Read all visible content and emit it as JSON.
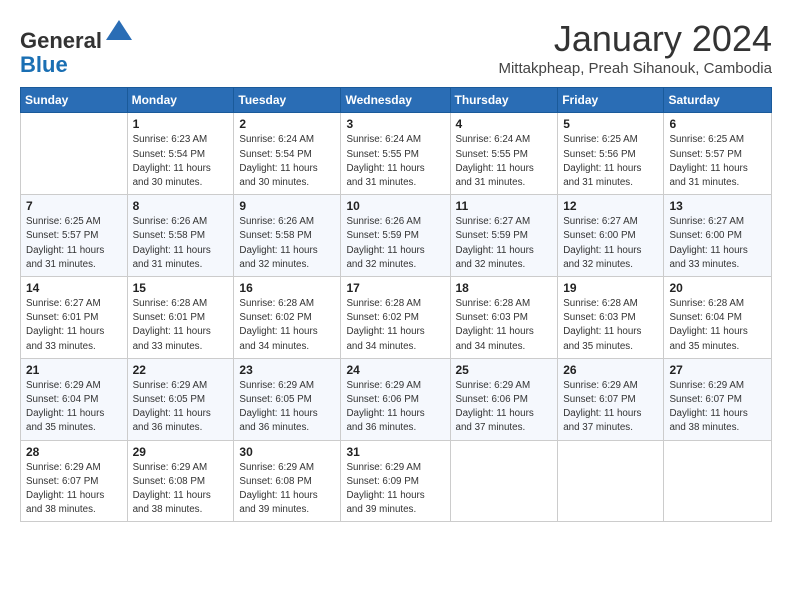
{
  "header": {
    "logo_line1": "General",
    "logo_line2": "Blue",
    "month_title": "January 2024",
    "subtitle": "Mittakpheap, Preah Sihanouk, Cambodia"
  },
  "weekdays": [
    "Sunday",
    "Monday",
    "Tuesday",
    "Wednesday",
    "Thursday",
    "Friday",
    "Saturday"
  ],
  "weeks": [
    [
      {
        "day": "",
        "info": ""
      },
      {
        "day": "1",
        "info": "Sunrise: 6:23 AM\nSunset: 5:54 PM\nDaylight: 11 hours\nand 30 minutes."
      },
      {
        "day": "2",
        "info": "Sunrise: 6:24 AM\nSunset: 5:54 PM\nDaylight: 11 hours\nand 30 minutes."
      },
      {
        "day": "3",
        "info": "Sunrise: 6:24 AM\nSunset: 5:55 PM\nDaylight: 11 hours\nand 31 minutes."
      },
      {
        "day": "4",
        "info": "Sunrise: 6:24 AM\nSunset: 5:55 PM\nDaylight: 11 hours\nand 31 minutes."
      },
      {
        "day": "5",
        "info": "Sunrise: 6:25 AM\nSunset: 5:56 PM\nDaylight: 11 hours\nand 31 minutes."
      },
      {
        "day": "6",
        "info": "Sunrise: 6:25 AM\nSunset: 5:57 PM\nDaylight: 11 hours\nand 31 minutes."
      }
    ],
    [
      {
        "day": "7",
        "info": "Sunrise: 6:25 AM\nSunset: 5:57 PM\nDaylight: 11 hours\nand 31 minutes."
      },
      {
        "day": "8",
        "info": "Sunrise: 6:26 AM\nSunset: 5:58 PM\nDaylight: 11 hours\nand 31 minutes."
      },
      {
        "day": "9",
        "info": "Sunrise: 6:26 AM\nSunset: 5:58 PM\nDaylight: 11 hours\nand 32 minutes."
      },
      {
        "day": "10",
        "info": "Sunrise: 6:26 AM\nSunset: 5:59 PM\nDaylight: 11 hours\nand 32 minutes."
      },
      {
        "day": "11",
        "info": "Sunrise: 6:27 AM\nSunset: 5:59 PM\nDaylight: 11 hours\nand 32 minutes."
      },
      {
        "day": "12",
        "info": "Sunrise: 6:27 AM\nSunset: 6:00 PM\nDaylight: 11 hours\nand 32 minutes."
      },
      {
        "day": "13",
        "info": "Sunrise: 6:27 AM\nSunset: 6:00 PM\nDaylight: 11 hours\nand 33 minutes."
      }
    ],
    [
      {
        "day": "14",
        "info": "Sunrise: 6:27 AM\nSunset: 6:01 PM\nDaylight: 11 hours\nand 33 minutes."
      },
      {
        "day": "15",
        "info": "Sunrise: 6:28 AM\nSunset: 6:01 PM\nDaylight: 11 hours\nand 33 minutes."
      },
      {
        "day": "16",
        "info": "Sunrise: 6:28 AM\nSunset: 6:02 PM\nDaylight: 11 hours\nand 34 minutes."
      },
      {
        "day": "17",
        "info": "Sunrise: 6:28 AM\nSunset: 6:02 PM\nDaylight: 11 hours\nand 34 minutes."
      },
      {
        "day": "18",
        "info": "Sunrise: 6:28 AM\nSunset: 6:03 PM\nDaylight: 11 hours\nand 34 minutes."
      },
      {
        "day": "19",
        "info": "Sunrise: 6:28 AM\nSunset: 6:03 PM\nDaylight: 11 hours\nand 35 minutes."
      },
      {
        "day": "20",
        "info": "Sunrise: 6:28 AM\nSunset: 6:04 PM\nDaylight: 11 hours\nand 35 minutes."
      }
    ],
    [
      {
        "day": "21",
        "info": "Sunrise: 6:29 AM\nSunset: 6:04 PM\nDaylight: 11 hours\nand 35 minutes."
      },
      {
        "day": "22",
        "info": "Sunrise: 6:29 AM\nSunset: 6:05 PM\nDaylight: 11 hours\nand 36 minutes."
      },
      {
        "day": "23",
        "info": "Sunrise: 6:29 AM\nSunset: 6:05 PM\nDaylight: 11 hours\nand 36 minutes."
      },
      {
        "day": "24",
        "info": "Sunrise: 6:29 AM\nSunset: 6:06 PM\nDaylight: 11 hours\nand 36 minutes."
      },
      {
        "day": "25",
        "info": "Sunrise: 6:29 AM\nSunset: 6:06 PM\nDaylight: 11 hours\nand 37 minutes."
      },
      {
        "day": "26",
        "info": "Sunrise: 6:29 AM\nSunset: 6:07 PM\nDaylight: 11 hours\nand 37 minutes."
      },
      {
        "day": "27",
        "info": "Sunrise: 6:29 AM\nSunset: 6:07 PM\nDaylight: 11 hours\nand 38 minutes."
      }
    ],
    [
      {
        "day": "28",
        "info": "Sunrise: 6:29 AM\nSunset: 6:07 PM\nDaylight: 11 hours\nand 38 minutes."
      },
      {
        "day": "29",
        "info": "Sunrise: 6:29 AM\nSunset: 6:08 PM\nDaylight: 11 hours\nand 38 minutes."
      },
      {
        "day": "30",
        "info": "Sunrise: 6:29 AM\nSunset: 6:08 PM\nDaylight: 11 hours\nand 39 minutes."
      },
      {
        "day": "31",
        "info": "Sunrise: 6:29 AM\nSunset: 6:09 PM\nDaylight: 11 hours\nand 39 minutes."
      },
      {
        "day": "",
        "info": ""
      },
      {
        "day": "",
        "info": ""
      },
      {
        "day": "",
        "info": ""
      }
    ]
  ]
}
